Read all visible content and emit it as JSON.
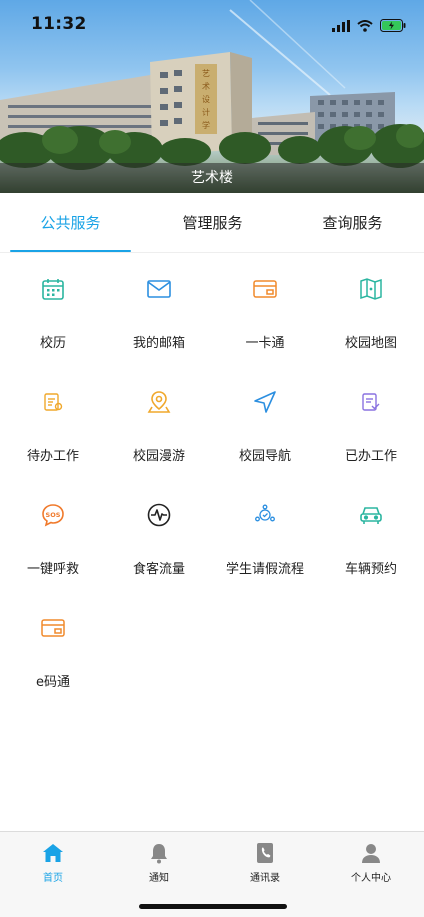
{
  "status_bar": {
    "time": "11:32",
    "icons": [
      "signal-icon",
      "wifi-icon",
      "battery-charging-icon"
    ]
  },
  "banner": {
    "caption": "艺术楼",
    "building_sign": "艺术设计学院"
  },
  "tabs": [
    {
      "label": "公共服务",
      "active": true
    },
    {
      "label": "管理服务",
      "active": false
    },
    {
      "label": "查询服务",
      "active": false
    }
  ],
  "services": [
    {
      "label": "校历",
      "icon": "calendar-icon",
      "color": "#2bb5a0"
    },
    {
      "label": "我的邮箱",
      "icon": "mail-icon",
      "color": "#2c8fe0"
    },
    {
      "label": "一卡通",
      "icon": "card-icon",
      "color": "#f08a2c"
    },
    {
      "label": "校园地图",
      "icon": "map-icon",
      "color": "#2bb5a0"
    },
    {
      "label": "待办工作",
      "icon": "todo-icon",
      "color": "#f0a82c"
    },
    {
      "label": "校园漫游",
      "icon": "location-pin-icon",
      "color": "#f0a82c"
    },
    {
      "label": "校园导航",
      "icon": "navigation-icon",
      "color": "#2c8fe0"
    },
    {
      "label": "已办工作",
      "icon": "done-document-icon",
      "color": "#8a72e0"
    },
    {
      "label": "一键呼救",
      "icon": "sos-icon",
      "color": "#f07a2c"
    },
    {
      "label": "食客流量",
      "icon": "pulse-icon",
      "color": "#222222"
    },
    {
      "label": "学生请假流程",
      "icon": "leave-process-icon",
      "color": "#2c8fe0"
    },
    {
      "label": "车辆预约",
      "icon": "car-icon",
      "color": "#2bb5a0"
    },
    {
      "label": "e码通",
      "icon": "e-card-icon",
      "color": "#f08a2c"
    }
  ],
  "bottom_nav": [
    {
      "label": "首页",
      "icon": "home-icon",
      "active": true
    },
    {
      "label": "通知",
      "icon": "bell-icon",
      "active": false
    },
    {
      "label": "通讯录",
      "icon": "contacts-icon",
      "active": false
    },
    {
      "label": "个人中心",
      "icon": "person-icon",
      "active": false
    }
  ],
  "colors": {
    "accent": "#1aa3e6",
    "nav_inactive": "#888888"
  }
}
